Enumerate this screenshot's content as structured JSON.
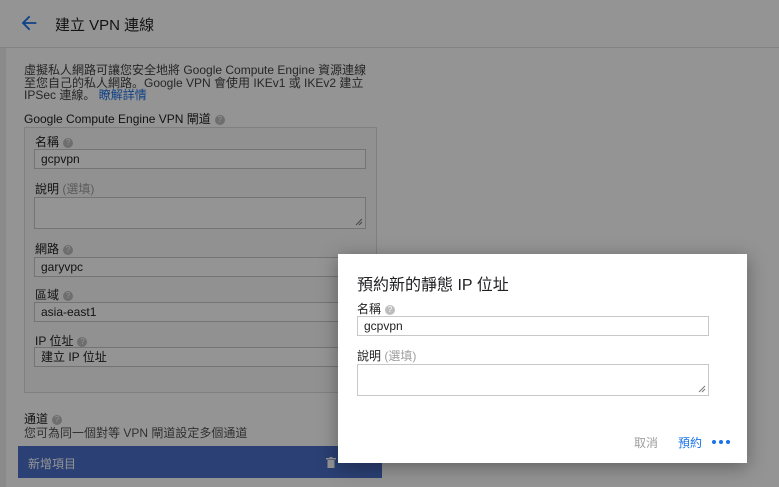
{
  "header": {
    "title": "建立 VPN 連線"
  },
  "intro": {
    "text": "虛擬私人網路可讓您安全地將 Google Compute Engine 資源連線至您自己的私人網路。Google VPN 會使用 IKEv1 或 IKEv2 建立 IPSec 連線。",
    "link": "瞭解詳情"
  },
  "gateway": {
    "section_label": "Google Compute Engine VPN 閘道",
    "name_label": "名稱",
    "name_value": "gcpvpn",
    "desc_label": "說明",
    "optional": "(選填)",
    "network_label": "網路",
    "network_value": "garyvpc",
    "region_label": "區域",
    "region_value": "asia-east1",
    "ip_label": "IP 位址",
    "ip_value": "建立 IP 位址"
  },
  "tunnels": {
    "label": "通道",
    "hint": "您可為同一個對等 VPN 閘道設定多個通道",
    "new_item": "新增項目"
  },
  "dialog": {
    "title": "預約新的靜態 IP 位址",
    "name_label": "名稱",
    "name_value": "gcpvpn",
    "desc_label": "說明",
    "optional": "(選填)",
    "cancel": "取消",
    "reserve": "預約"
  },
  "colors": {
    "accent": "#1a73e8",
    "bar": "#4a6fc9",
    "overlay": "rgba(0,0,0,0.42)"
  },
  "icons": [
    "back-arrow-icon",
    "help-icon",
    "trash-icon",
    "resize-grip-icon",
    "loading-dots-icon"
  ]
}
